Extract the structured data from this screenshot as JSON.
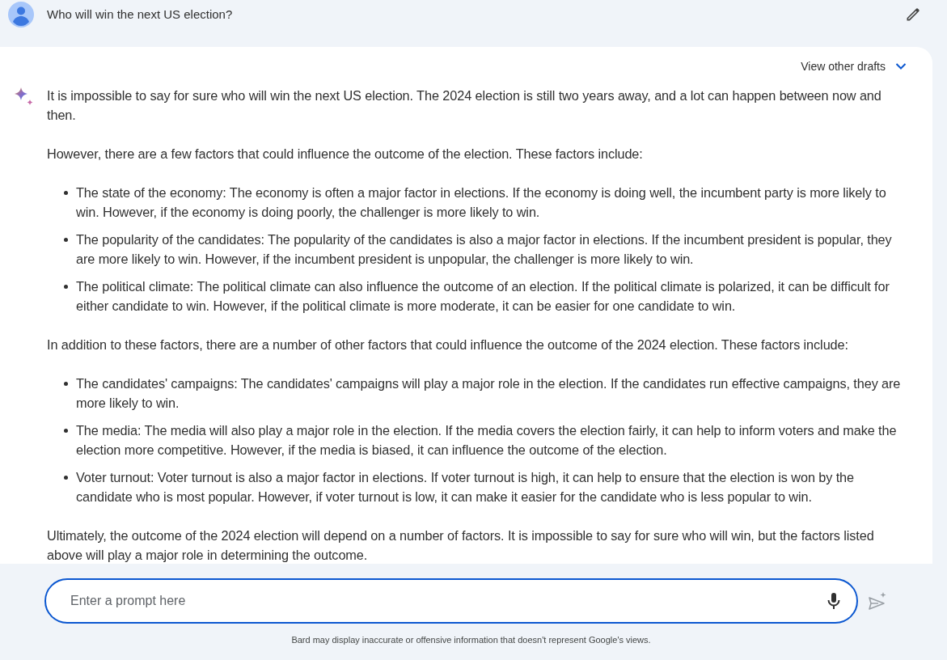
{
  "user_prompt": {
    "text": "Who will win the next US election?"
  },
  "response": {
    "drafts_label": "View other drafts",
    "blocks": [
      {
        "kind": "paragraph",
        "text": "It is impossible to say for sure who will win the next US election. The 2024 election is still two years away, and a lot can happen between now and then."
      },
      {
        "kind": "paragraph",
        "text": "However, there are a few factors that could influence the outcome of the election. These factors include:"
      },
      {
        "kind": "list",
        "items": [
          "The state of the economy: The economy is often a major factor in elections. If the economy is doing well, the incumbent party is more likely to win. However, if the economy is doing poorly, the challenger is more likely to win.",
          "The popularity of the candidates: The popularity of the candidates is also a major factor in elections. If the incumbent president is popular, they are more likely to win. However, if the incumbent president is unpopular, the challenger is more likely to win.",
          "The political climate: The political climate can also influence the outcome of an election. If the political climate is polarized, it can be difficult for either candidate to win. However, if the political climate is more moderate, it can be easier for one candidate to win."
        ]
      },
      {
        "kind": "paragraph",
        "text": "In addition to these factors, there are a number of other factors that could influence the outcome of the 2024 election. These factors include:"
      },
      {
        "kind": "list",
        "items": [
          "The candidates' campaigns: The candidates' campaigns will play a major role in the election. If the candidates run effective campaigns, they are more likely to win.",
          "The media: The media will also play a major role in the election. If the media covers the election fairly, it can help to inform voters and make the election more competitive. However, if the media is biased, it can influence the outcome of the election.",
          "Voter turnout: Voter turnout is also a major factor in elections. If voter turnout is high, it can help to ensure that the election is won by the candidate who is most popular. However, if voter turnout is low, it can make it easier for the candidate who is less popular to win."
        ]
      },
      {
        "kind": "paragraph",
        "text": "Ultimately, the outcome of the 2024 election will depend on a number of factors. It is impossible to say for sure who will win, but the factors listed above will play a major role in determining the outcome."
      }
    ]
  },
  "prompt_input": {
    "placeholder": "Enter a prompt here"
  },
  "disclaimer": "Bard may display inaccurate or offensive information that doesn't represent Google's views."
}
